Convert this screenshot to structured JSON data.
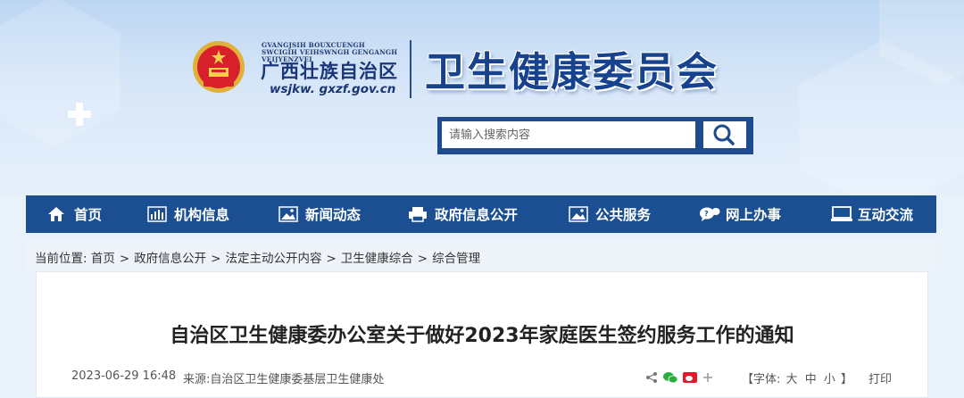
{
  "header": {
    "zhuang_text": "GVANGJSIH BOUXCUENGH SWCIGIH VEIHSWNGH GENGANGH VEIJYENZVEI",
    "region_name": "广西壮族自治区",
    "site_url": "wsjkw. gxzf.gov.cn",
    "dept_title": "卫生健康委员会"
  },
  "search": {
    "placeholder": "请输入搜索内容"
  },
  "nav": {
    "items": [
      {
        "label": "首页",
        "icon": "home-icon"
      },
      {
        "label": "机构信息",
        "icon": "bar-chart-icon"
      },
      {
        "label": "新闻动态",
        "icon": "image-icon"
      },
      {
        "label": "政府信息公开",
        "icon": "printer-icon"
      },
      {
        "label": "公共服务",
        "icon": "image-icon"
      },
      {
        "label": "网上办事",
        "icon": "chat-icon"
      },
      {
        "label": "互动交流",
        "icon": "monitor-icon"
      }
    ]
  },
  "breadcrumb": {
    "prefix": "当前位置:",
    "items": [
      "首页",
      "政府信息公开",
      "法定主动公开内容",
      "卫生健康综合",
      "综合管理"
    ],
    "separator": ">"
  },
  "article": {
    "title": "自治区卫生健康委办公室关于做好2023年家庭医生签约服务工作的通知",
    "datetime": "2023-06-29 16:48",
    "source": "来源:自治区卫生健康委基层卫生健康处",
    "font_label_open": "【字体:",
    "font_sizes": [
      "大",
      "中",
      "小"
    ],
    "font_label_close": "】",
    "print_label": "打印"
  },
  "colors": {
    "nav_bg": "#1b4f92",
    "title_blue": "#17438e",
    "header_bg": "#cfe2f6"
  }
}
